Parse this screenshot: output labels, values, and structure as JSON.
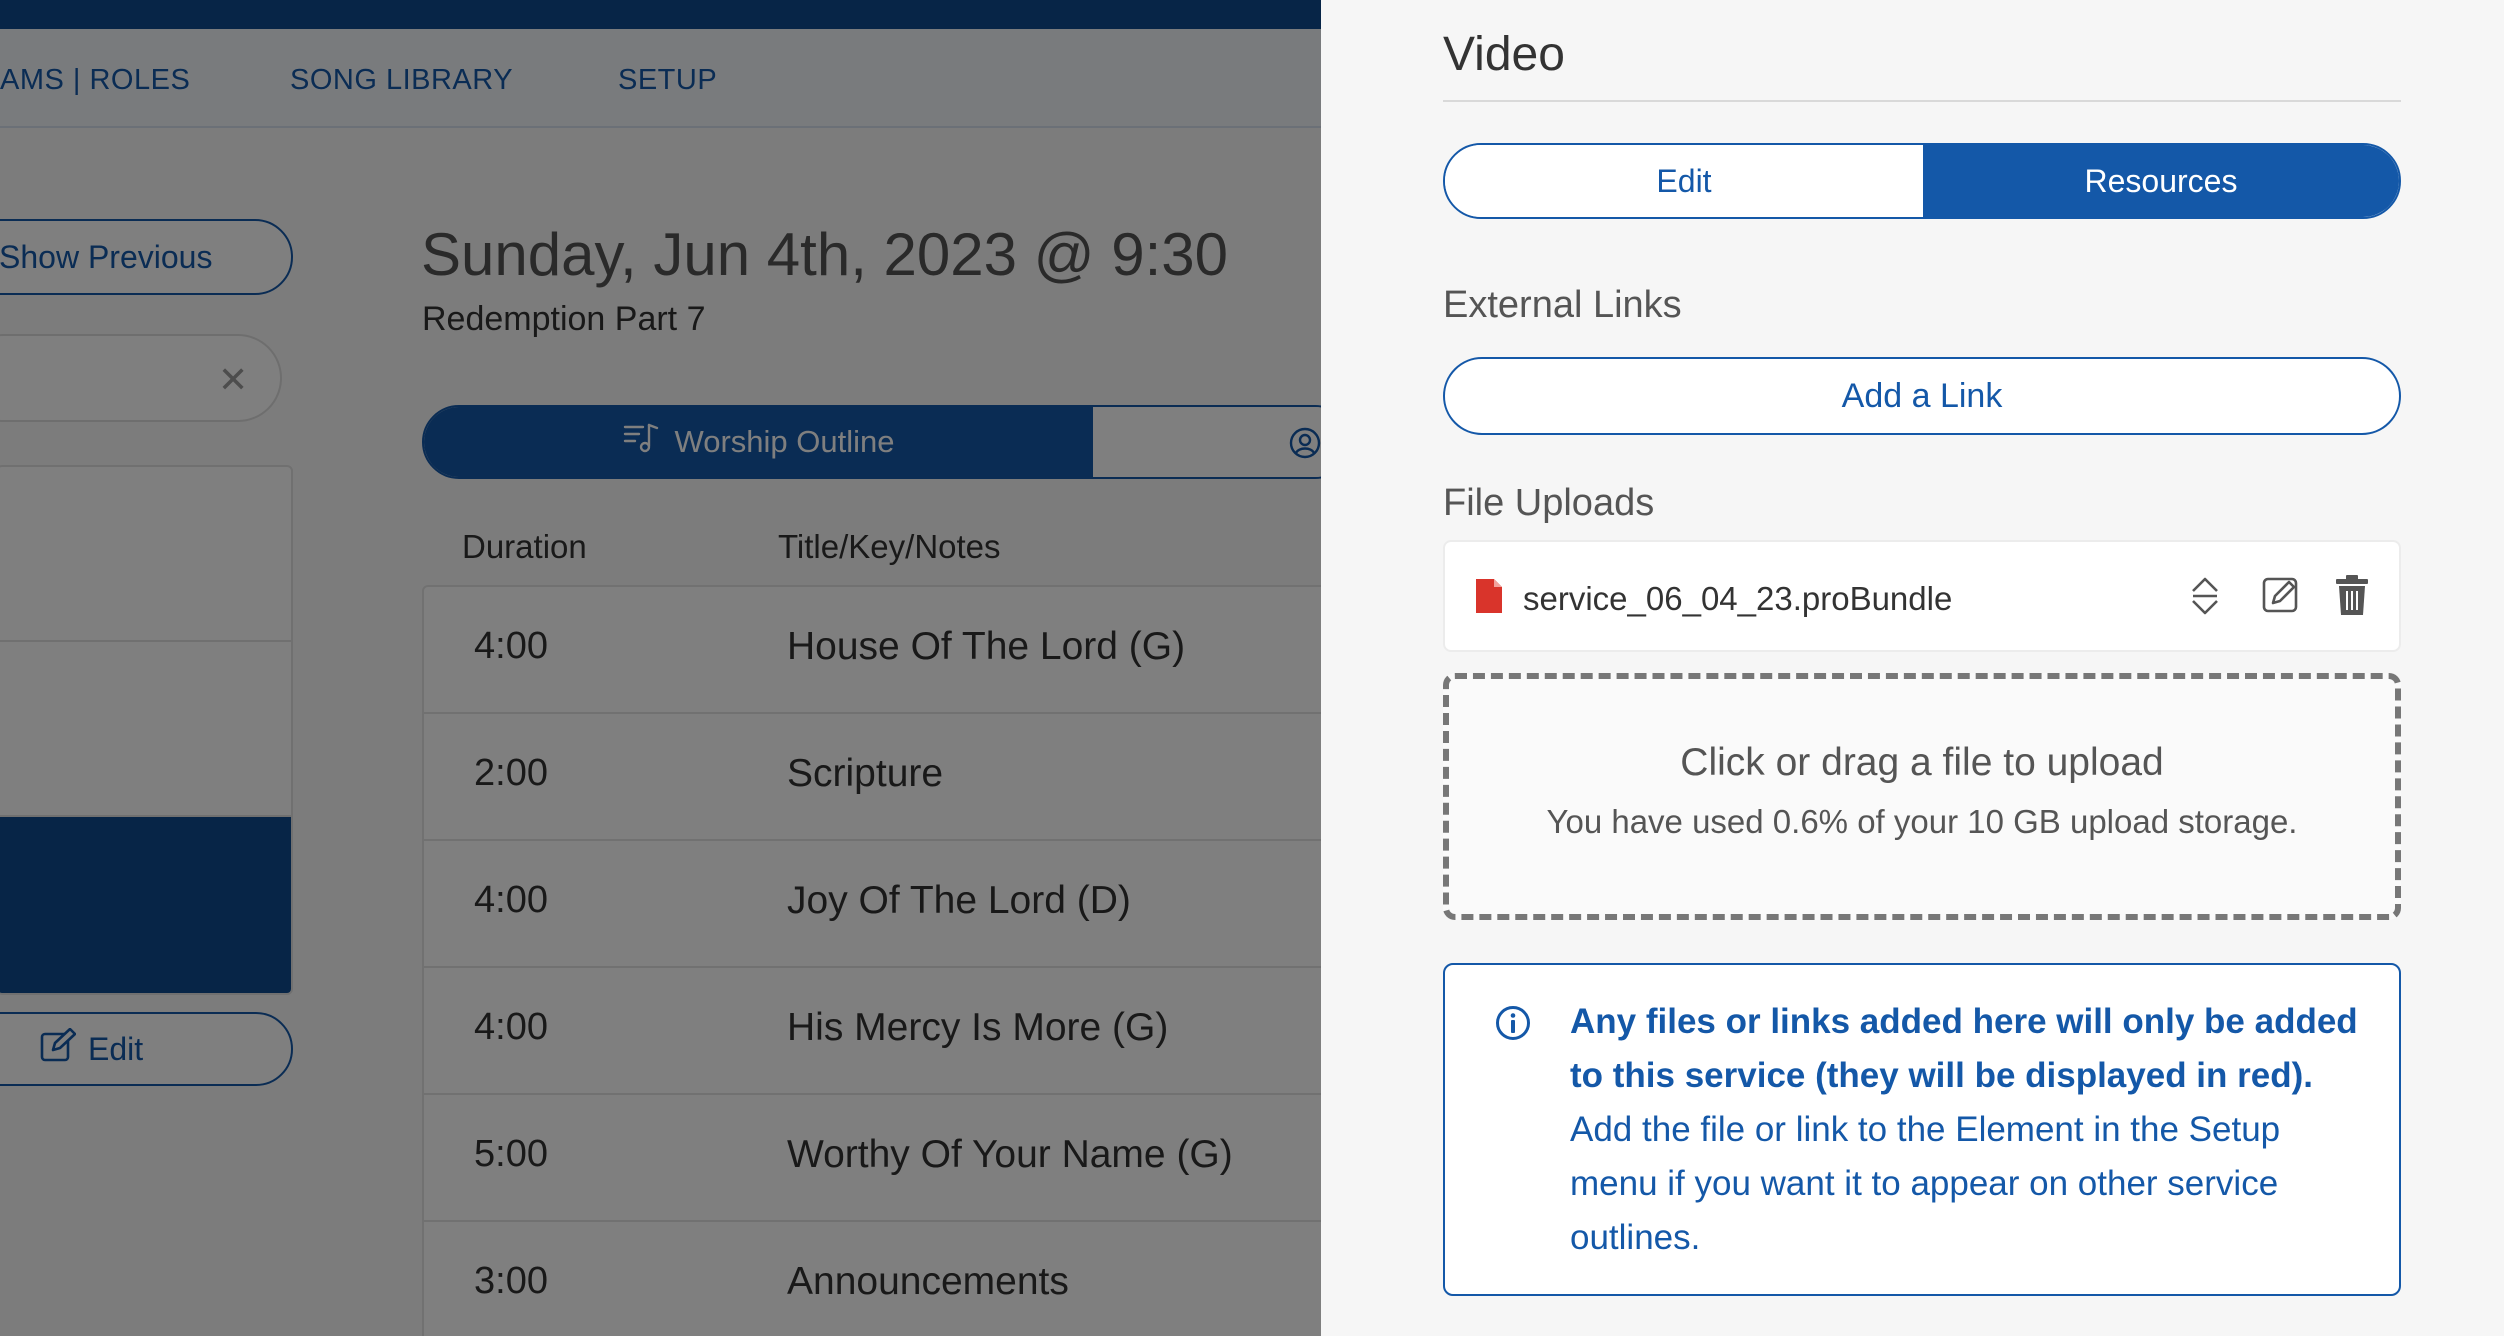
{
  "nav": {
    "items": [
      "AMS | ROLES",
      "SONG LIBRARY",
      "SETUP"
    ]
  },
  "sidebar": {
    "show_previous_label": "Show Previous",
    "edit_label": "Edit"
  },
  "service": {
    "date": "Sunday, Jun 4th, 2023 @ 9:30",
    "subtitle": "Redemption Part 7",
    "tab_outline": "Worship Outline"
  },
  "outline": {
    "headers": {
      "duration": "Duration",
      "title": "Title/Key/Notes"
    },
    "rows": [
      {
        "duration": "4:00",
        "title": "House Of The Lord (G)"
      },
      {
        "duration": "2:00",
        "title": "Scripture"
      },
      {
        "duration": "4:00",
        "title": "Joy Of The Lord (D)"
      },
      {
        "duration": "4:00",
        "title": "His Mercy Is More (G)"
      },
      {
        "duration": "5:00",
        "title": "Worthy Of Your Name (G)"
      },
      {
        "duration": "3:00",
        "title": "Announcements"
      }
    ]
  },
  "panel": {
    "title": "Video",
    "tabs": {
      "edit": "Edit",
      "resources": "Resources",
      "active": "resources"
    },
    "external_links_heading": "External Links",
    "add_link_label": "Add a Link",
    "file_uploads_heading": "File Uploads",
    "file": {
      "name": "service_06_04_23.proBundle",
      "icon": "file-icon",
      "icon_color": "#d9342b"
    },
    "dropzone": {
      "main": "Click or drag a file to upload",
      "sub": "You have used 0.6% of your 10 GB upload storage."
    },
    "note": {
      "bold": "Any files or links added here will only be added to this service (they will be displayed in red).",
      "rest": " Add the file or link to the Element in the Setup menu if you want it to appear on other service outlines."
    }
  },
  "colors": {
    "brand": "#1458a8",
    "brand_dark": "#0f4a8f",
    "file_red": "#d9342b"
  }
}
